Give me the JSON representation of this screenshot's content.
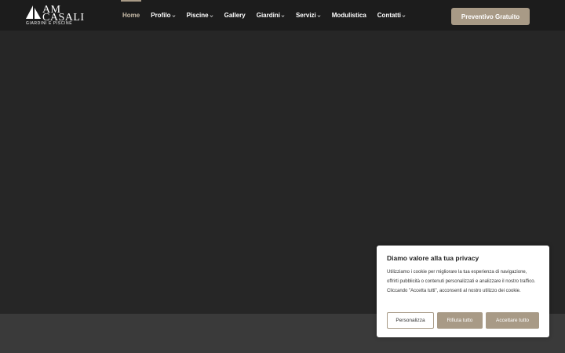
{
  "brand": {
    "name_line1": "AM",
    "name_line2": "CASALI",
    "tagline": "GIARDINI E PISCINE"
  },
  "nav": {
    "items": [
      {
        "label": "Home",
        "active": true,
        "dropdown": false
      },
      {
        "label": "Profilo",
        "active": false,
        "dropdown": true
      },
      {
        "label": "Piscine",
        "active": false,
        "dropdown": true
      },
      {
        "label": "Gallery",
        "active": false,
        "dropdown": false
      },
      {
        "label": "Giardini",
        "active": false,
        "dropdown": true
      },
      {
        "label": "Servizi",
        "active": false,
        "dropdown": true
      },
      {
        "label": "Modulistica",
        "active": false,
        "dropdown": false
      },
      {
        "label": "Contatti",
        "active": false,
        "dropdown": true
      }
    ]
  },
  "header": {
    "cta_label": "Preventivo Gratuito"
  },
  "cookie_banner": {
    "title": "Diamo valore alla tua privacy",
    "text": "Utilizziamo i cookie per migliorare la tua esperienza di navigazione, offrirti pubblicità o contenuti personalizzati e analizzare il nostro traffico. Cliccando \"Accetta tutti\", acconsenti al nostro utilizzo dei cookie.",
    "customize_label": "Personalizza",
    "reject_label": "Rifiuta tutto",
    "accept_label": "Accettare tutto"
  },
  "colors": {
    "accent": "#a89a86",
    "header_bg": "#1c1c1c",
    "hero_bg": "#262626",
    "footer_band": "#3a3a3a"
  },
  "icons": {
    "logo": "sail-logo-icon",
    "dropdown": "chevron-down-icon"
  }
}
